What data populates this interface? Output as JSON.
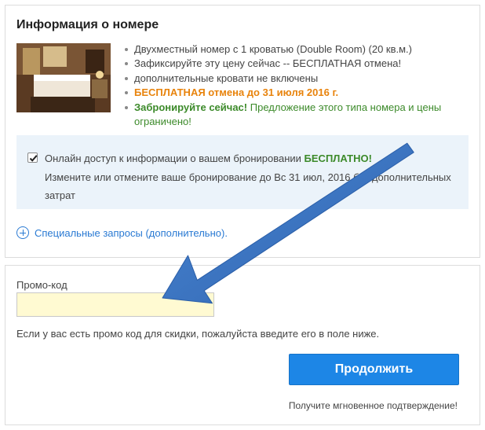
{
  "room_section": {
    "title": "Информация о номере",
    "features": {
      "room_type": "Двухместный номер с 1 кроватью (Double Room) (20 кв.м.)",
      "fix_price": "Зафиксируйте эту цену сейчас -- БЕСПЛАТНАЯ отмена!",
      "extra_beds": "дополнительные кровати не включены",
      "free_cancel": "БЕСПЛАТНАЯ отмена до 31 июля 2016 г.",
      "book_now_bold": "Забронируйте сейчас!",
      "book_now_rest_1": "Предложение этого типа номера и цены",
      "book_now_rest_2": "ограничено!"
    },
    "online_access": {
      "checked": true,
      "text": "Онлайн доступ к информации о вашем бронировании",
      "emphasis": "БЕСПЛАТНО!",
      "sub_1": "Измените или отмените ваше бронирование до Вс 31 июл, 2016 без дополнительных",
      "sub_2": "затрат"
    },
    "special_requests": "Специальные запросы (дополнительно)."
  },
  "promo_section": {
    "label": "Промо-код",
    "input_value": "",
    "hint": "Если у вас есть промо код для скидки, пожалуйста введите его в поле ниже.",
    "continue_label": "Продолжить",
    "confirm_note": "Получите мгновенное подтверждение!"
  },
  "colors": {
    "accent_blue": "#1d86e6",
    "link_blue": "#2a7ad3",
    "orange": "#e8830c",
    "green": "#3c8a2a",
    "info_bg": "#ebf3fa",
    "input_bg": "#fffad2",
    "annotation_arrow": "#3a75c4"
  },
  "icons": [
    "room-photo",
    "checkbox-check-icon",
    "plus-circle-icon",
    "annotation-arrow-icon"
  ]
}
